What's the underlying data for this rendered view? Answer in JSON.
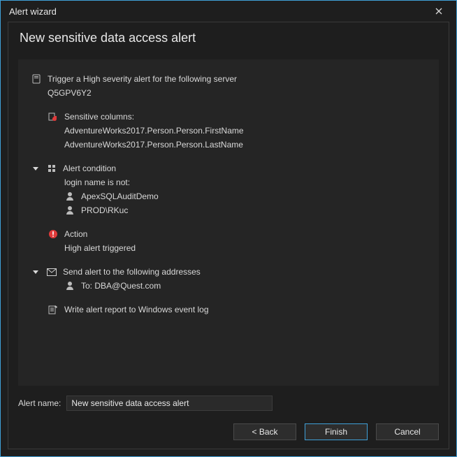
{
  "window": {
    "title": "Alert wizard"
  },
  "heading": "New sensitive data access alert",
  "summary": {
    "trigger_label": "Trigger a High severity alert for the following server",
    "server": "Q5GPV6Y2",
    "sensitive_columns_label": "Sensitive columns:",
    "sensitive_columns": [
      "AdventureWorks2017.Person.Person.FirstName",
      "AdventureWorks2017.Person.Person.LastName"
    ],
    "condition_heading": "Alert condition",
    "condition_label": "login name is not:",
    "condition_values": [
      "ApexSQLAuditDemo",
      "PROD\\RKuc"
    ],
    "action_heading": "Action",
    "action_text": "High alert triggered",
    "send_label": "Send alert to the following addresses",
    "recipients": [
      "To: DBA@Quest.com"
    ],
    "event_log_label": "Write alert report to Windows event log"
  },
  "alert_name": {
    "label": "Alert name:",
    "value": "New sensitive data access alert"
  },
  "buttons": {
    "back": "< Back",
    "finish": "Finish",
    "cancel": "Cancel"
  }
}
